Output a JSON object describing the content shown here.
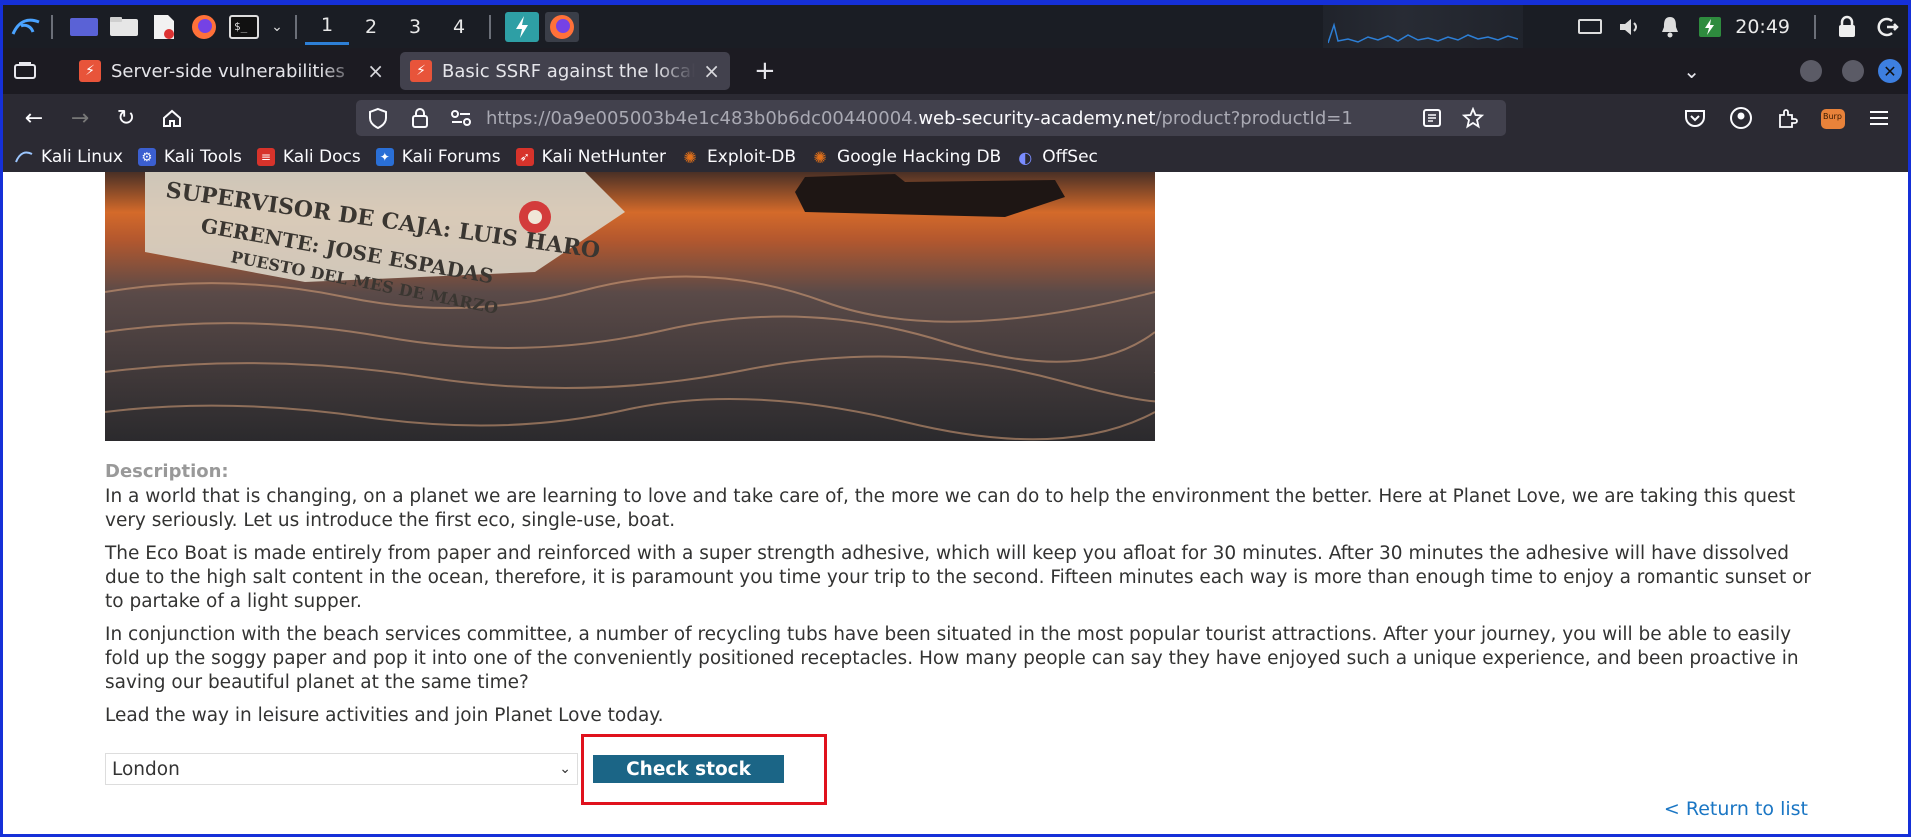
{
  "taskbar": {
    "workspaces": [
      "1",
      "2",
      "3",
      "4"
    ],
    "clock": "20:49"
  },
  "tabs": [
    {
      "title": "Server-side vulnerabilities",
      "close": "×"
    },
    {
      "title": "Basic SSRF against the local server",
      "close": "×"
    }
  ],
  "new_tab": "+",
  "navbar": {
    "url_prefix": "https://0a9e005003b4e1c483b0b6dc00440004.",
    "url_host": "web-security-academy.net",
    "url_path": "/product?productId=1"
  },
  "bookmarks": [
    {
      "label": "Kali Linux",
      "icon": "kali-icon",
      "color": "#2a6fd6"
    },
    {
      "label": "Kali Tools",
      "icon": "kali-tools-icon",
      "color": "#3b5fd0"
    },
    {
      "label": "Kali Docs",
      "icon": "kali-docs-icon",
      "color": "#d7332b"
    },
    {
      "label": "Kali Forums",
      "icon": "kali-forums-icon",
      "color": "#2a6fd6"
    },
    {
      "label": "Kali NetHunter",
      "icon": "nethunter-icon",
      "color": "#d7332b"
    },
    {
      "label": "Exploit-DB",
      "icon": "exploitdb-icon",
      "color": "#e0701b"
    },
    {
      "label": "Google Hacking DB",
      "icon": "ghdb-icon",
      "color": "#e0701b"
    },
    {
      "label": "OffSec",
      "icon": "offsec-icon",
      "color": "#5a6df0"
    }
  ],
  "product": {
    "description_label": "Description:",
    "paragraphs": [
      "In a world that is changing, on a planet we are learning to love and take care of, the more we can do to help the environment the better. Here at Planet Love, we are taking this quest very seriously. Let us introduce the first eco, single-use, boat.",
      "The Eco Boat is made entirely from paper and reinforced with a super strength adhesive, which will keep you afloat for 30 minutes. After 30 minutes the adhesive will have dissolved due to the high salt content in the ocean, therefore, it is paramount you time your trip to the second. Fifteen minutes each way is more than enough time to enjoy a romantic sunset or to partake of a light supper.",
      "In conjunction with the beach services committee, a number of recycling tubs have been situated in the most popular tourist attractions. After your journey, you will be able to easily fold up the soggy paper and pop it into one of the conveniently positioned receptacles. How many people can say they have enjoyed such a unique experience, and been proactive in saving our beautiful planet at the same time?",
      "Lead the way in leisure activities and join Planet Love today."
    ],
    "image_text": [
      "SUPERVISOR DE CAJA: LUIS HARO",
      "GERENTE: JOSE ESPADAS",
      "PUESTO DEL MES DE MARZO"
    ]
  },
  "stock": {
    "selected_store": "London",
    "check_label": "Check stock"
  },
  "return_link": "< Return to list",
  "colors": {
    "accent_button": "#1b6586",
    "highlight_box": "#e0111d",
    "link": "#1a76c4"
  }
}
